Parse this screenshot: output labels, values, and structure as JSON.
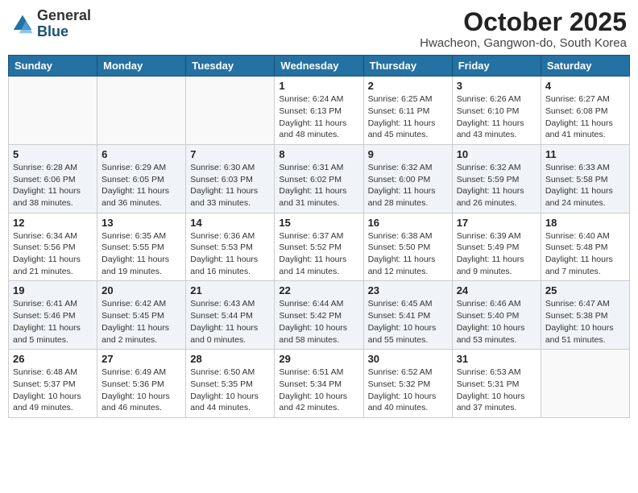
{
  "header": {
    "logo_general": "General",
    "logo_blue": "Blue",
    "month": "October 2025",
    "location": "Hwacheon, Gangwon-do, South Korea"
  },
  "weekdays": [
    "Sunday",
    "Monday",
    "Tuesday",
    "Wednesday",
    "Thursday",
    "Friday",
    "Saturday"
  ],
  "weeks": [
    [
      {
        "day": "",
        "detail": ""
      },
      {
        "day": "",
        "detail": ""
      },
      {
        "day": "",
        "detail": ""
      },
      {
        "day": "1",
        "detail": "Sunrise: 6:24 AM\nSunset: 6:13 PM\nDaylight: 11 hours\nand 48 minutes."
      },
      {
        "day": "2",
        "detail": "Sunrise: 6:25 AM\nSunset: 6:11 PM\nDaylight: 11 hours\nand 45 minutes."
      },
      {
        "day": "3",
        "detail": "Sunrise: 6:26 AM\nSunset: 6:10 PM\nDaylight: 11 hours\nand 43 minutes."
      },
      {
        "day": "4",
        "detail": "Sunrise: 6:27 AM\nSunset: 6:08 PM\nDaylight: 11 hours\nand 41 minutes."
      }
    ],
    [
      {
        "day": "5",
        "detail": "Sunrise: 6:28 AM\nSunset: 6:06 PM\nDaylight: 11 hours\nand 38 minutes."
      },
      {
        "day": "6",
        "detail": "Sunrise: 6:29 AM\nSunset: 6:05 PM\nDaylight: 11 hours\nand 36 minutes."
      },
      {
        "day": "7",
        "detail": "Sunrise: 6:30 AM\nSunset: 6:03 PM\nDaylight: 11 hours\nand 33 minutes."
      },
      {
        "day": "8",
        "detail": "Sunrise: 6:31 AM\nSunset: 6:02 PM\nDaylight: 11 hours\nand 31 minutes."
      },
      {
        "day": "9",
        "detail": "Sunrise: 6:32 AM\nSunset: 6:00 PM\nDaylight: 11 hours\nand 28 minutes."
      },
      {
        "day": "10",
        "detail": "Sunrise: 6:32 AM\nSunset: 5:59 PM\nDaylight: 11 hours\nand 26 minutes."
      },
      {
        "day": "11",
        "detail": "Sunrise: 6:33 AM\nSunset: 5:58 PM\nDaylight: 11 hours\nand 24 minutes."
      }
    ],
    [
      {
        "day": "12",
        "detail": "Sunrise: 6:34 AM\nSunset: 5:56 PM\nDaylight: 11 hours\nand 21 minutes."
      },
      {
        "day": "13",
        "detail": "Sunrise: 6:35 AM\nSunset: 5:55 PM\nDaylight: 11 hours\nand 19 minutes."
      },
      {
        "day": "14",
        "detail": "Sunrise: 6:36 AM\nSunset: 5:53 PM\nDaylight: 11 hours\nand 16 minutes."
      },
      {
        "day": "15",
        "detail": "Sunrise: 6:37 AM\nSunset: 5:52 PM\nDaylight: 11 hours\nand 14 minutes."
      },
      {
        "day": "16",
        "detail": "Sunrise: 6:38 AM\nSunset: 5:50 PM\nDaylight: 11 hours\nand 12 minutes."
      },
      {
        "day": "17",
        "detail": "Sunrise: 6:39 AM\nSunset: 5:49 PM\nDaylight: 11 hours\nand 9 minutes."
      },
      {
        "day": "18",
        "detail": "Sunrise: 6:40 AM\nSunset: 5:48 PM\nDaylight: 11 hours\nand 7 minutes."
      }
    ],
    [
      {
        "day": "19",
        "detail": "Sunrise: 6:41 AM\nSunset: 5:46 PM\nDaylight: 11 hours\nand 5 minutes."
      },
      {
        "day": "20",
        "detail": "Sunrise: 6:42 AM\nSunset: 5:45 PM\nDaylight: 11 hours\nand 2 minutes."
      },
      {
        "day": "21",
        "detail": "Sunrise: 6:43 AM\nSunset: 5:44 PM\nDaylight: 11 hours\nand 0 minutes."
      },
      {
        "day": "22",
        "detail": "Sunrise: 6:44 AM\nSunset: 5:42 PM\nDaylight: 10 hours\nand 58 minutes."
      },
      {
        "day": "23",
        "detail": "Sunrise: 6:45 AM\nSunset: 5:41 PM\nDaylight: 10 hours\nand 55 minutes."
      },
      {
        "day": "24",
        "detail": "Sunrise: 6:46 AM\nSunset: 5:40 PM\nDaylight: 10 hours\nand 53 minutes."
      },
      {
        "day": "25",
        "detail": "Sunrise: 6:47 AM\nSunset: 5:38 PM\nDaylight: 10 hours\nand 51 minutes."
      }
    ],
    [
      {
        "day": "26",
        "detail": "Sunrise: 6:48 AM\nSunset: 5:37 PM\nDaylight: 10 hours\nand 49 minutes."
      },
      {
        "day": "27",
        "detail": "Sunrise: 6:49 AM\nSunset: 5:36 PM\nDaylight: 10 hours\nand 46 minutes."
      },
      {
        "day": "28",
        "detail": "Sunrise: 6:50 AM\nSunset: 5:35 PM\nDaylight: 10 hours\nand 44 minutes."
      },
      {
        "day": "29",
        "detail": "Sunrise: 6:51 AM\nSunset: 5:34 PM\nDaylight: 10 hours\nand 42 minutes."
      },
      {
        "day": "30",
        "detail": "Sunrise: 6:52 AM\nSunset: 5:32 PM\nDaylight: 10 hours\nand 40 minutes."
      },
      {
        "day": "31",
        "detail": "Sunrise: 6:53 AM\nSunset: 5:31 PM\nDaylight: 10 hours\nand 37 minutes."
      },
      {
        "day": "",
        "detail": ""
      }
    ]
  ]
}
